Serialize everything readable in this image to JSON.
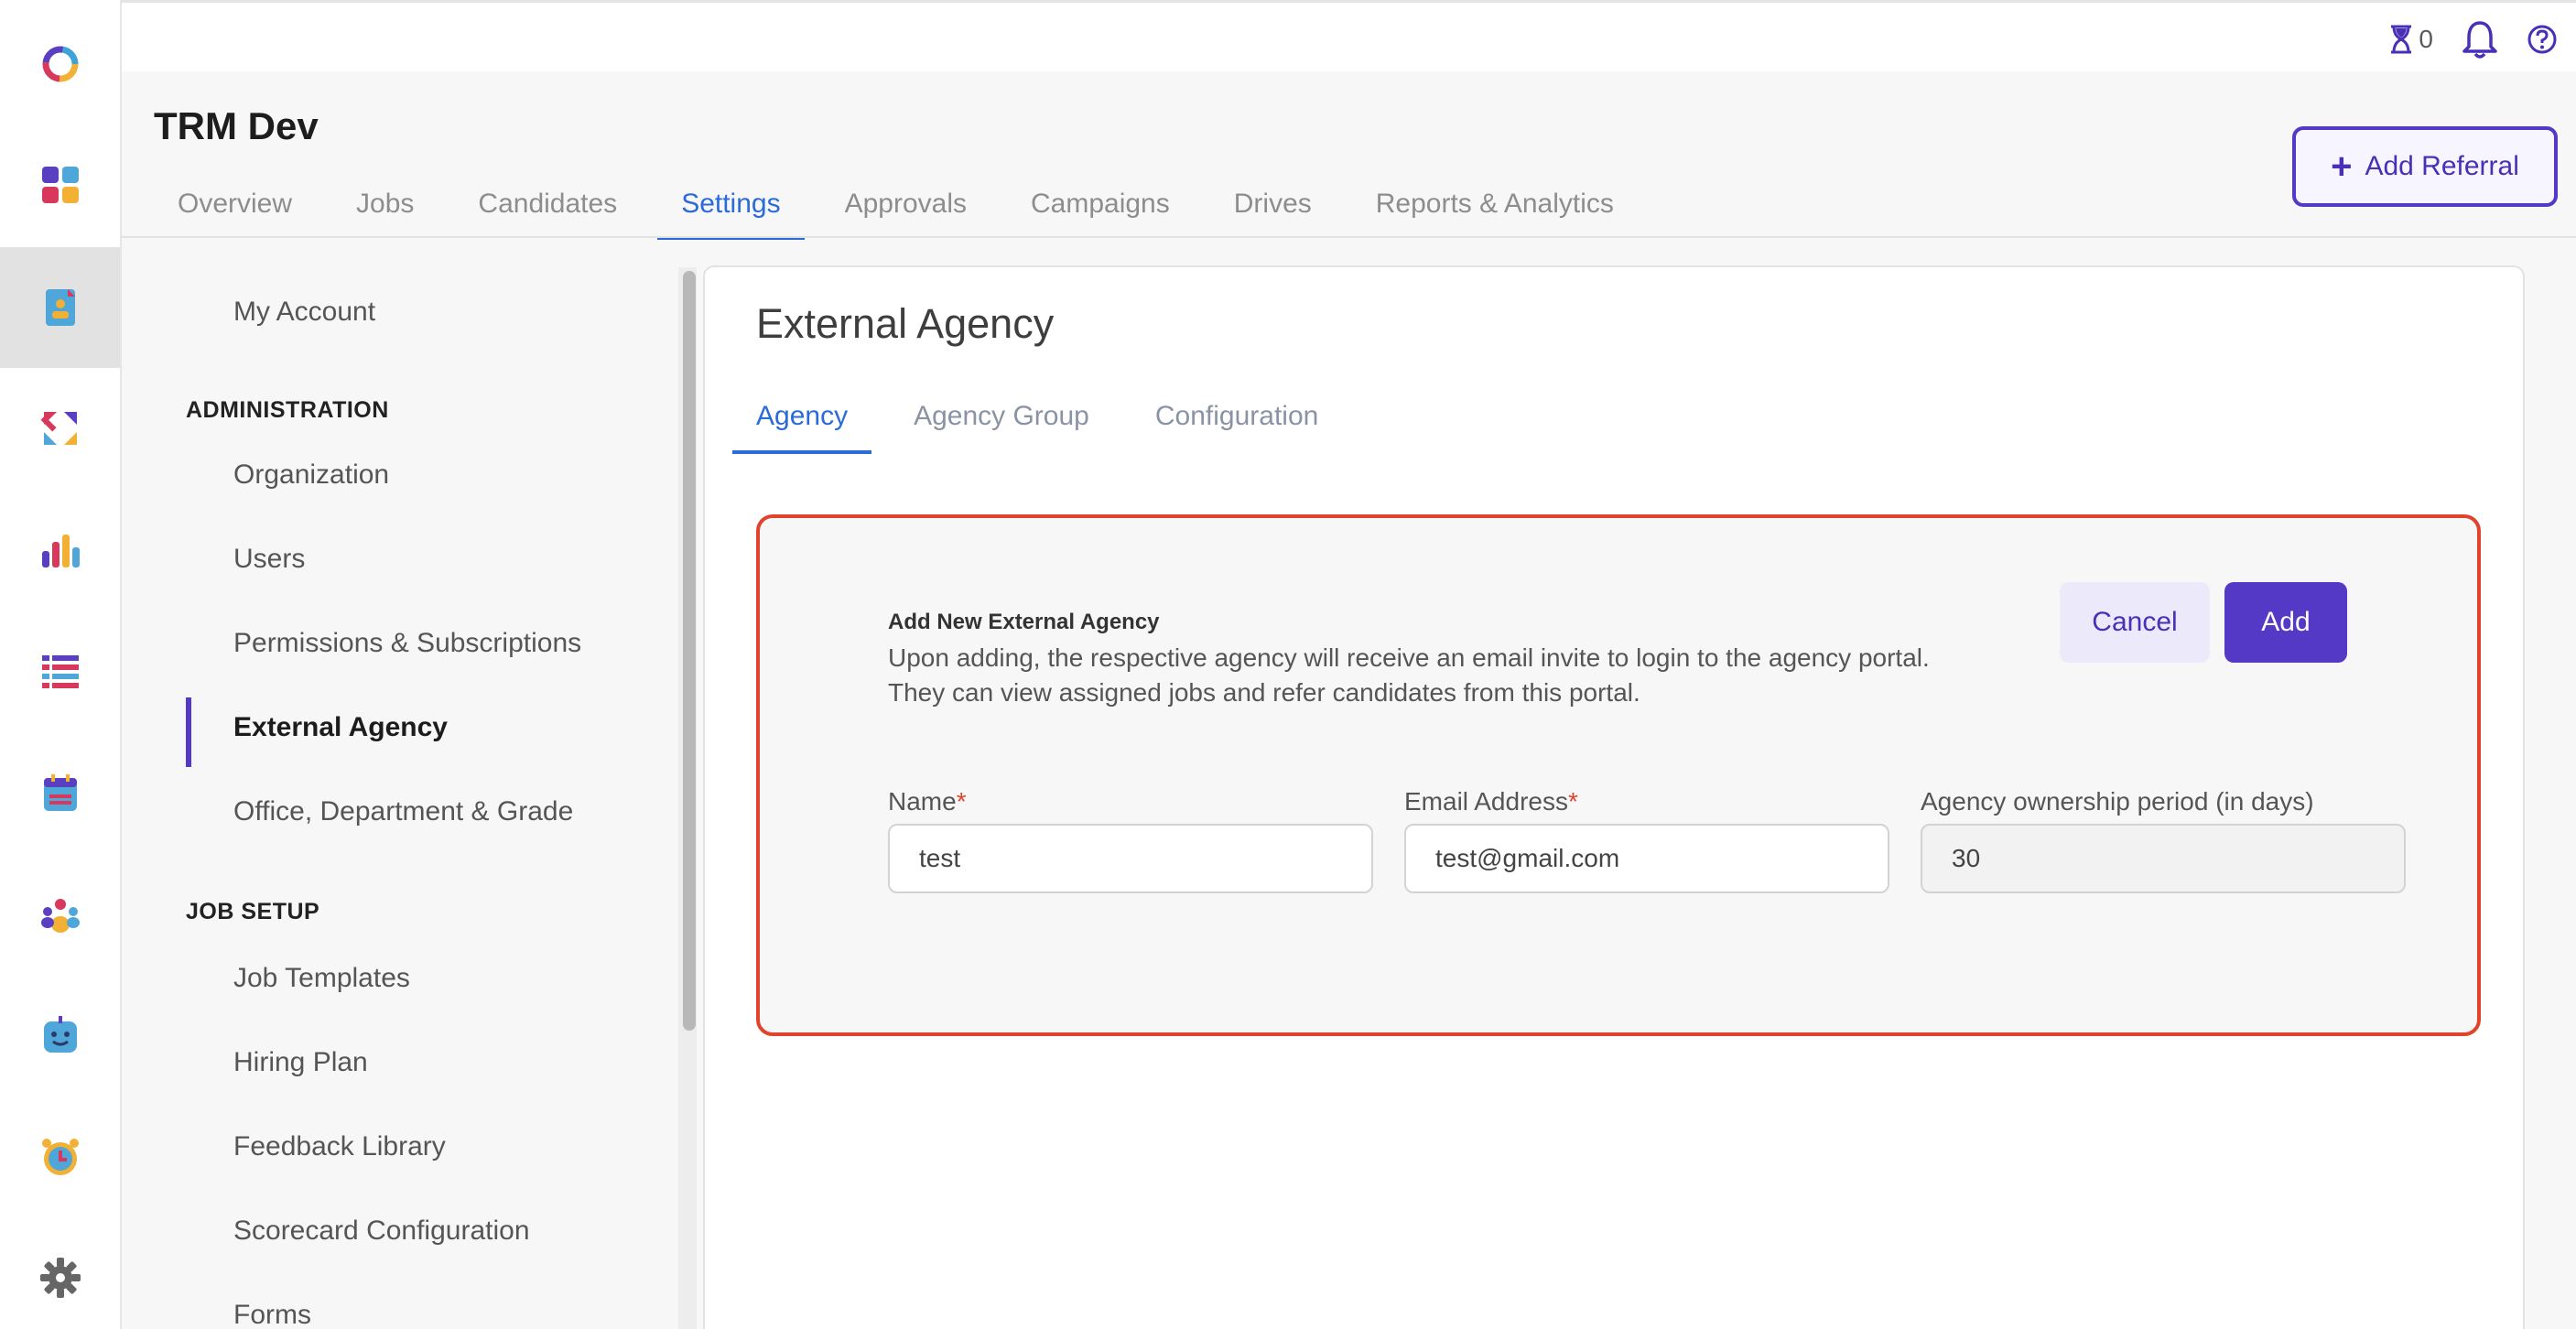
{
  "rail": {
    "items": [
      {
        "name": "logo-icon"
      },
      {
        "name": "dashboard-icon"
      },
      {
        "name": "document-icon",
        "active": true
      },
      {
        "name": "referral-arrows-icon"
      },
      {
        "name": "analytics-icon"
      },
      {
        "name": "list-icon"
      },
      {
        "name": "calendar-icon"
      },
      {
        "name": "team-icon"
      },
      {
        "name": "bot-icon"
      },
      {
        "name": "clock-icon"
      },
      {
        "name": "gear-icon"
      }
    ]
  },
  "topbar": {
    "timer_count": "0"
  },
  "header": {
    "title": "TRM Dev",
    "tabs": [
      {
        "label": "Overview"
      },
      {
        "label": "Jobs"
      },
      {
        "label": "Candidates"
      },
      {
        "label": "Settings",
        "active": true
      },
      {
        "label": "Approvals"
      },
      {
        "label": "Campaigns"
      },
      {
        "label": "Drives"
      },
      {
        "label": "Reports & Analytics"
      }
    ],
    "add_referral_label": "Add Referral"
  },
  "settings_nav": {
    "my_account": "My Account",
    "section_admin": "ADMINISTRATION",
    "admin_items": [
      "Organization",
      "Users",
      "Permissions & Subscriptions",
      "External Agency",
      "Office, Department & Grade"
    ],
    "section_job_setup": "JOB SETUP",
    "job_setup_items": [
      "Job Templates",
      "Hiring Plan",
      "Feedback Library",
      "Scorecard Configuration",
      "Forms"
    ]
  },
  "main": {
    "title": "External Agency",
    "sub_tabs": [
      {
        "label": "Agency",
        "active": true
      },
      {
        "label": "Agency Group"
      },
      {
        "label": "Configuration"
      }
    ],
    "form": {
      "heading": "Add New External Agency",
      "description_line1": "Upon adding, the respective agency will receive an email invite to login to the agency portal.",
      "description_line2": "They can view assigned jobs and refer candidates from this portal.",
      "cancel_label": "Cancel",
      "add_label": "Add",
      "name_label": "Name",
      "name_value": "test",
      "email_label": "Email Address",
      "email_value": "test@gmail.com",
      "ownership_label": "Agency ownership period (in days)",
      "ownership_value": "30",
      "required_mark": "*"
    }
  },
  "colors": {
    "accent": "#5438c6",
    "tab_active": "#2a6bd8",
    "highlight_border": "#e0442c"
  }
}
